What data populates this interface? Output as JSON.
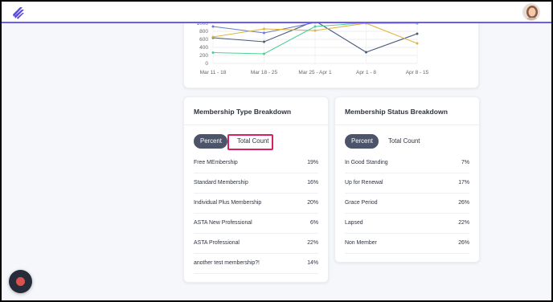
{
  "colors": {
    "accent_line": "#6b5cf0",
    "logo": "#5b4fd6",
    "pill_active": "#4b5468",
    "highlight": "#d6225f"
  },
  "icons": {
    "logo": "app-logo-icon",
    "avatar": "user-avatar",
    "record": "record-icon"
  },
  "chart_data": {
    "type": "line",
    "categories": [
      "Mar 11 - 18",
      "Mar 18 - 25",
      "Mar 25 - Apr 1",
      "Apr 1 - 8",
      "Apr 8 - 15"
    ],
    "y_ticks": [
      "0",
      "200",
      "400",
      "600",
      "800",
      "1000"
    ],
    "ylim": [
      0,
      1000
    ],
    "grid": true,
    "series": [
      {
        "color": "#4a5a7a",
        "values": [
          640,
          540,
          1060,
          280,
          740
        ]
      },
      {
        "color": "#6a7cc9",
        "values": [
          920,
          760,
          1020,
          1000,
          1000
        ]
      },
      {
        "color": "#e0b43c",
        "values": [
          660,
          860,
          820,
          1000,
          500
        ]
      },
      {
        "color": "#4fcf97",
        "values": [
          270,
          240,
          920,
          1010,
          1000
        ]
      }
    ]
  },
  "membership_type": {
    "title": "Membership Type Breakdown",
    "toggle": {
      "percent": "Percent",
      "total_count": "Total Count"
    },
    "rows": [
      {
        "label": "Free MEmbership",
        "value": "19%"
      },
      {
        "label": "Standard Membership",
        "value": "16%"
      },
      {
        "label": "Individual Plus Membership",
        "value": "20%"
      },
      {
        "label": "ASTA New Professional",
        "value": "6%"
      },
      {
        "label": "ASTA Professional",
        "value": "22%"
      },
      {
        "label": "another test membership?!",
        "value": "14%"
      }
    ]
  },
  "membership_status": {
    "title": "Membership Status Breakdown",
    "toggle": {
      "percent": "Percent",
      "total_count": "Total Count"
    },
    "rows": [
      {
        "label": "In Good Standing",
        "value": "7%"
      },
      {
        "label": "Up for Renewal",
        "value": "17%"
      },
      {
        "label": "Grace Period",
        "value": "26%"
      },
      {
        "label": "Lapsed",
        "value": "22%"
      },
      {
        "label": "Non Member",
        "value": "26%"
      }
    ]
  }
}
